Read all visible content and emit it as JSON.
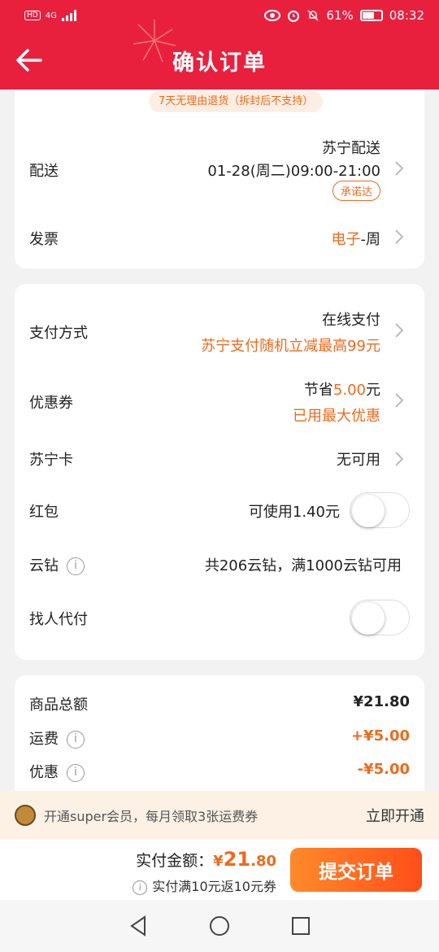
{
  "status": {
    "signal": "4G",
    "battery_pct": "61%",
    "time": "08:32"
  },
  "header": {
    "title": "确认订单"
  },
  "return_policy": "7天无理由退货（拆封后不支持）",
  "delivery": {
    "label": "配送",
    "provider": "苏宁配送",
    "slot": "01-28(周二)09:00-21:00",
    "badge": "承诺达"
  },
  "invoice": {
    "label": "发票",
    "value_type": "电子",
    "value_rest": "-周"
  },
  "payment": {
    "label": "支付方式",
    "value": "在线支付",
    "promo": "苏宁支付随机立减最高99元"
  },
  "coupon": {
    "label": "优惠券",
    "save_prefix": "节省",
    "save_amount": "5.00",
    "save_suffix": "元",
    "note": "已用最大优惠"
  },
  "suning_card": {
    "label": "苏宁卡",
    "value": "无可用"
  },
  "red_packet": {
    "label": "红包",
    "value": "可使用1.40元",
    "enabled": false
  },
  "cloud_diamond": {
    "label": "云钻",
    "value": "共206云钻，满1000云钻可用"
  },
  "pay_for_me": {
    "label": "找人代付",
    "enabled": false
  },
  "summary": {
    "goods_label": "商品总额",
    "goods_value": "¥21.80",
    "shipping_label": "运费",
    "shipping_value": "+¥5.00",
    "discount_label": "优惠",
    "discount_value": "-¥5.00"
  },
  "promo_bar": {
    "text": "开通super会员，每月领取3张运费券",
    "link": "立即开通"
  },
  "footer": {
    "total_label": "实付金额：",
    "currency": "¥",
    "total_int": "21",
    "total_dec": ".80",
    "rebate": "实付满10元返10元券",
    "submit": "提交订单"
  },
  "colors": {
    "brand_red": "#e8203e",
    "accent_orange": "#ee6a1c"
  }
}
